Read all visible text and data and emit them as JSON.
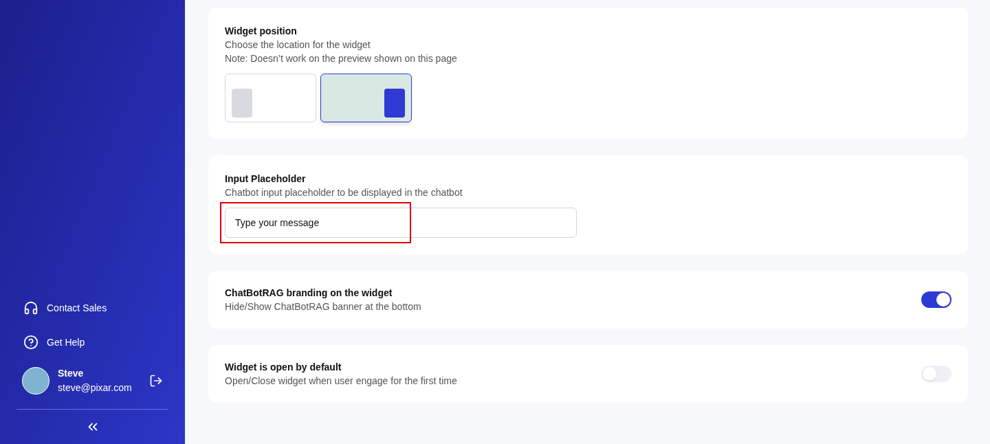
{
  "sidebar": {
    "links": [
      {
        "kind": "headset",
        "label": "Contact Sales"
      },
      {
        "kind": "help",
        "label": "Get Help"
      }
    ],
    "user": {
      "name": "Steve",
      "email": "steve@pixar.com"
    }
  },
  "settings": [
    {
      "kind": "position",
      "title": "Widget position",
      "descriptions": [
        "Choose the location for the widget",
        "Note: Doesn’t work on the preview shown on this page"
      ],
      "options": [
        {
          "kind": "left",
          "selected": false
        },
        {
          "kind": "right",
          "selected": true
        }
      ]
    },
    {
      "kind": "input",
      "title": "Input Placeholder",
      "descriptions": [
        "Chatbot input placeholder to be displayed in the chatbot"
      ],
      "value": "Type your message",
      "highlighted": true
    },
    {
      "kind": "toggle",
      "title": "ChatBotRAG branding on the widget",
      "descriptions": [
        "Hide/Show ChatBotRAG banner at the bottom"
      ],
      "on": true
    },
    {
      "kind": "toggle",
      "title": "Widget is open by default",
      "descriptions": [
        "Open/Close widget when user engage for the first time"
      ],
      "on": false
    }
  ]
}
